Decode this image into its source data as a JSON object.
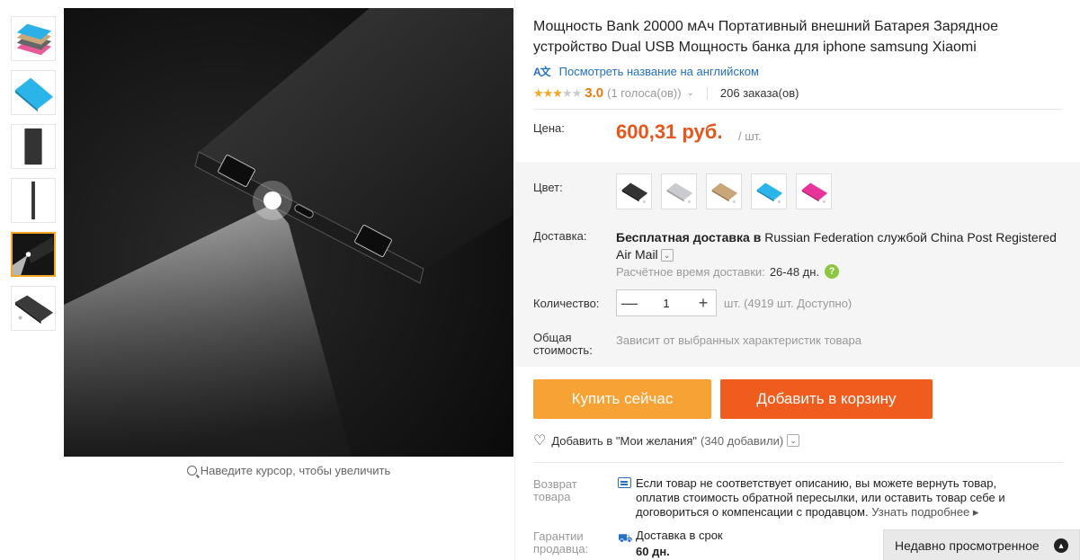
{
  "product": {
    "title": "Мощность Bank 20000 мАч Портативный внешний Батарея Зарядное устройство Dual USB Мощность банка для iphone samsung Xiaomi",
    "translate_link": "Посмотреть название на английском",
    "rating": {
      "value": "3.0",
      "stars_filled": 3,
      "stars_total": 5,
      "votes": "(1 голоса(ов))",
      "orders": "206 заказа(ов)"
    },
    "price": {
      "label": "Цена:",
      "value": "600,31 руб.",
      "unit": "/ шт."
    },
    "color": {
      "label": "Цвет:",
      "swatches": [
        "black",
        "silver",
        "gold",
        "blue",
        "pink"
      ]
    },
    "shipping": {
      "label": "Доставка:",
      "text_bold": "Бесплатная доставка в",
      "text_rest": " Russian Federation службой China Post Registered Air Mail",
      "eta_label": "Расчётное время доставки:",
      "eta_value": "26-48 дн."
    },
    "quantity": {
      "label": "Количество:",
      "minus": "—",
      "value": "1",
      "plus": "+",
      "stock": "шт. (4919 шт. Доступно)"
    },
    "total": {
      "label_line1": "Общая",
      "label_line2": "стоимость:",
      "text": "Зависит от выбранных характеристик товара"
    },
    "buttons": {
      "buy_now": "Купить сейчас",
      "add_to_cart": "Добавить в корзину"
    },
    "wishlist": {
      "text": "Добавить в \"Мои желания\"",
      "count": "(340 добавили)"
    },
    "returns": {
      "label_line1": "Возврат",
      "label_line2": "товара",
      "text": "Если товар не соответствует описанию, вы можете вернуть товар, оплатив стоимость обратной пересылки, или оставить товар себе и договориться о компенсации с продавцом.",
      "more": "Узнать подробнее ▸"
    },
    "guarantee": {
      "label_line1": "Гарантии",
      "label_line2": "продавца:",
      "text": "Доставка в срок",
      "days": "60 дн."
    }
  },
  "gallery": {
    "zoom_hint": "Наведите курсор, чтобы увеличить",
    "thumbnails": [
      "pink-blue-stack",
      "blue-single",
      "black-front",
      "black-edge",
      "black-flashlight",
      "black-angle"
    ],
    "active_index": 4
  },
  "recently_viewed": "Недавно просмотренное",
  "colors": {
    "price": "#e8551a",
    "buy_now": "#f7a234",
    "add_to_cart": "#f05c1d",
    "link": "#2470c2",
    "star": "#f5a623"
  }
}
